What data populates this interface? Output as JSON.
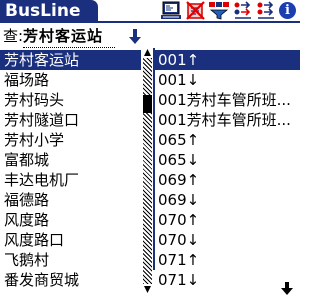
{
  "app": {
    "title": "BusLine"
  },
  "toolbar": {
    "icons": [
      "map-pc-icon",
      "no-card-icon",
      "filter-icon",
      "transfer-icon",
      "transfer-alt-icon",
      "info-icon"
    ],
    "info_glyph": "i"
  },
  "query": {
    "label": "查:",
    "value": "芳村客运站"
  },
  "stops": {
    "selected_index": 0,
    "items": [
      "芳村客运站",
      "福场路",
      "芳村码头",
      "芳村隧道口",
      "芳村小学",
      "富都城",
      "丰达电机厂",
      "福德路",
      "风度路",
      "风度路口",
      "飞鹅村",
      "番发商贸城"
    ]
  },
  "routes": {
    "selected_index": 0,
    "items": [
      "001↑",
      "001↓",
      "001芳村车管所班...",
      "001芳村车管所班...",
      "065↑",
      "065↓",
      "069↑",
      "069↓",
      "070↑",
      "070↓",
      "071↑",
      "071↓"
    ]
  },
  "scrollbar": {
    "position": 0.18
  },
  "colors": {
    "accent": "#1a2f7d",
    "info": "#1c3fb0"
  }
}
